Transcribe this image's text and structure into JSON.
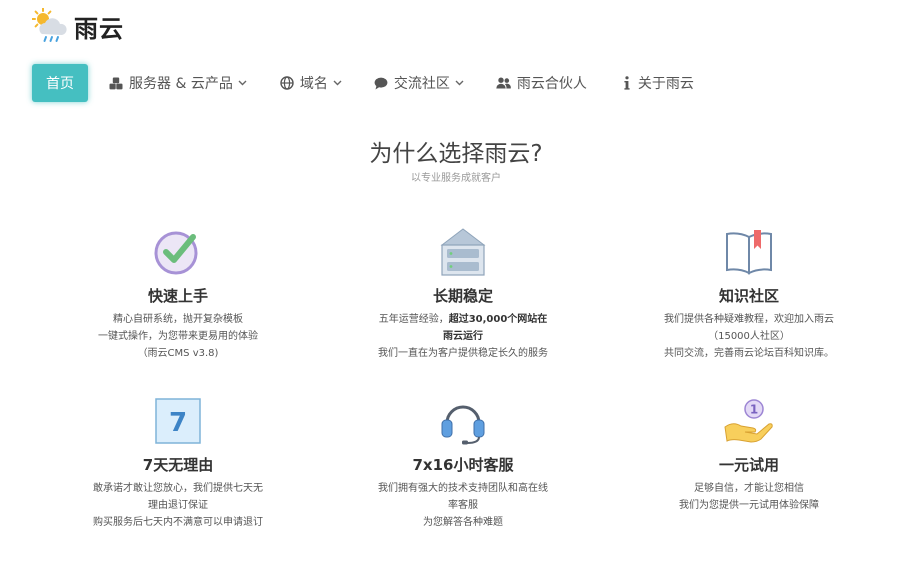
{
  "brand": {
    "name": "雨云"
  },
  "nav": [
    {
      "label": "首页",
      "icon": "",
      "dropdown": false,
      "active": true
    },
    {
      "label": "服务器 & 云产品",
      "icon": "cubes-icon",
      "dropdown": true
    },
    {
      "label": "域名",
      "icon": "globe-icon",
      "dropdown": true
    },
    {
      "label": "交流社区",
      "icon": "comment-icon",
      "dropdown": true
    },
    {
      "label": "雨云合伙人",
      "icon": "users-icon",
      "dropdown": false
    },
    {
      "label": "关于雨云",
      "icon": "info-icon",
      "dropdown": false
    }
  ],
  "hero": {
    "title": "为什么选择雨云?",
    "subtitle": "以专业服务成就客户"
  },
  "features": [
    {
      "icon": "checkmark-circle-icon",
      "title": "快速上手",
      "lines": [
        "精心自研系统，抛开复杂模板",
        "一键式操作，为您带来更易用的体验",
        "（雨云CMS v3.8)"
      ]
    },
    {
      "icon": "server-icon",
      "title": "长期稳定",
      "line1_pre": "五年运营经验，",
      "line1_bold": "超过30,000个网站在",
      "line2_bold": "雨云运行",
      "line3": "我们一直在为客户提供稳定长久的服务"
    },
    {
      "icon": "book-icon",
      "title": "知识社区",
      "lines": [
        "我们提供各种疑难教程，欢迎加入雨云",
        "（15000人社区）",
        "共同交流，完善雨云论坛百科知识库。"
      ]
    },
    {
      "icon": "calendar-7-icon",
      "icon_text": "7",
      "title": "7天无理由",
      "lines": [
        "敢承诺才敢让您放心，我们提供七天无",
        "理由退订保证",
        "购买服务后七天内不满意可以申请退订"
      ]
    },
    {
      "icon": "headset-icon",
      "title": "7x16小时客服",
      "lines": [
        "我们拥有强大的技术支持团队和高在线",
        "率客服",
        "为您解答各种难题"
      ]
    },
    {
      "icon": "coin-hand-icon",
      "icon_text": "1",
      "title": "一元试用",
      "lines": [
        "足够自信，才能让您相信",
        "我们为您提供一元试用体验保障"
      ]
    }
  ]
}
